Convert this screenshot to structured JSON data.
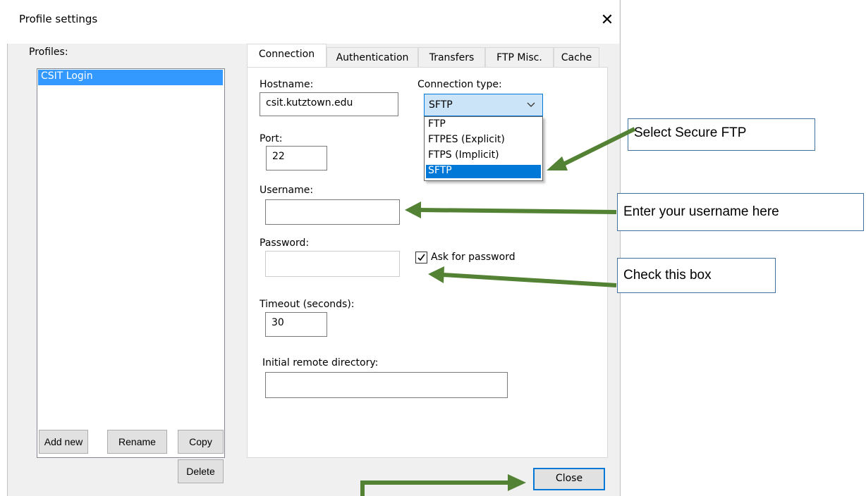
{
  "window": {
    "title": "Profile settings"
  },
  "profiles": {
    "label": "Profiles:",
    "items": [
      "CSIT Login"
    ],
    "buttons": {
      "add_new": "Add new",
      "rename": "Rename",
      "copy": "Copy",
      "delete": "Delete"
    }
  },
  "tabs": [
    "Connection",
    "Authentication",
    "Transfers",
    "FTP Misc.",
    "Cache"
  ],
  "connection": {
    "hostname_label": "Hostname:",
    "hostname_value": "csit.kutztown.edu",
    "connection_type_label": "Connection type:",
    "connection_type_value": "SFTP",
    "connection_type_options": [
      "FTP",
      "FTPES (Explicit)",
      "FTPS (Implicit)",
      "SFTP"
    ],
    "port_label": "Port:",
    "port_value": "22",
    "username_label": "Username:",
    "username_value": "",
    "password_label": "Password:",
    "ask_for_password_label": "Ask for password",
    "ask_for_password_checked": true,
    "timeout_label": "Timeout (seconds):",
    "timeout_value": "30",
    "initial_remote_dir_label": "Initial remote directory:",
    "initial_remote_dir_value": ""
  },
  "close_button": "Close",
  "annotations": {
    "select_secure_ftp": "Select Secure FTP",
    "enter_username": "Enter your username here",
    "check_box": "Check this box",
    "arrow_color": "#548235"
  }
}
